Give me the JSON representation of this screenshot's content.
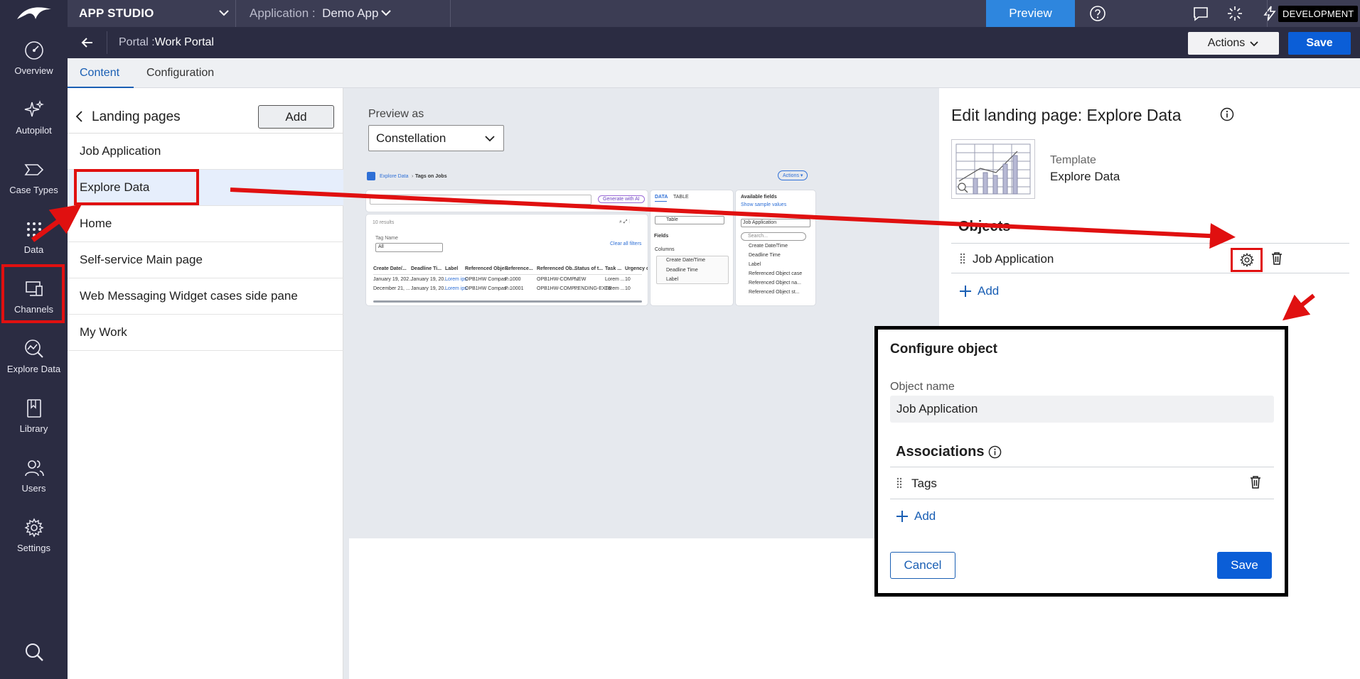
{
  "topbar": {
    "studio": "APP STUDIO",
    "app_label": "Application :",
    "app_name": "Demo App",
    "preview": "Preview",
    "environment": "DEVELOPMENT",
    "icons": [
      "help-icon",
      "chat-icon",
      "loader-icon",
      "lightning-icon",
      "hierarchy-icon"
    ]
  },
  "subbar": {
    "portal_label": "Portal :",
    "portal_name": "Work Portal",
    "actions": "Actions",
    "save": "Save"
  },
  "rail": {
    "items": [
      {
        "label": "Overview",
        "icon": "gauge-icon"
      },
      {
        "label": "Autopilot",
        "icon": "sparkle-icon"
      },
      {
        "label": "Case Types",
        "icon": "chevron-shape-icon"
      },
      {
        "label": "Data",
        "icon": "dots-grid-icon"
      },
      {
        "label": "Channels",
        "icon": "monitor-icon"
      },
      {
        "label": "Explore Data",
        "icon": "chart-search-icon"
      },
      {
        "label": "Library",
        "icon": "book-icon"
      },
      {
        "label": "Users",
        "icon": "users-icon"
      },
      {
        "label": "Settings",
        "icon": "gear-icon"
      }
    ]
  },
  "tabs": [
    {
      "label": "Content",
      "active": true
    },
    {
      "label": "Configuration",
      "active": false
    }
  ],
  "landing": {
    "title": "Landing pages",
    "add": "Add",
    "items": [
      {
        "label": "Job Application",
        "selected": false
      },
      {
        "label": "Explore Data",
        "selected": true
      },
      {
        "label": "Home",
        "selected": false
      },
      {
        "label": "Self-service Main page",
        "selected": false
      },
      {
        "label": "Web Messaging Widget cases side pane",
        "selected": false
      },
      {
        "label": "My Work",
        "selected": false
      }
    ]
  },
  "preview": {
    "label": "Preview as",
    "value": "Constellation",
    "mini": {
      "crumb1": "Explore Data",
      "crumb2": "Tags on Jobs",
      "actions": "Actions ▾",
      "gen_ai": "Generate with AI",
      "results": "10 results",
      "tag_name": "Tag Name",
      "tag_value": "All",
      "clear": "Clear all filters",
      "columns": [
        "Create Date/...",
        "Deadline Ti...",
        "Label",
        "Referenced Obje...",
        "Reference...",
        "Referenced Ob...",
        "Status of t...",
        "Task ...",
        "Urgency o..."
      ],
      "row1": [
        "January 19, 202...",
        "January 19, 20...",
        "Lorem ips",
        "OPB1HW Compas...",
        "P-1000",
        "OPB1HW-COMP...",
        "NEW",
        "Lorem ...",
        "10"
      ],
      "row2": [
        "December 21, ...",
        "January 19, 20...",
        "Lorem ips",
        "OPB1HW Compas...",
        "P-10001",
        "OPB1HW-COMP...",
        "PENDING-EXTE",
        "Lorem ...",
        "10"
      ],
      "data_tab": "DATA",
      "table_tab": "TABLE",
      "table_value": "Table",
      "fields": "Fields",
      "columns_lbl": "Columns",
      "col_items": [
        "Create Date/Time",
        "Deadline Time",
        "Label"
      ],
      "available": "Available fields",
      "show_sample": "Show sample values",
      "job_app": "Job Application",
      "search": "Search...",
      "avail_items": [
        "Create Date/Time",
        "Deadline Time",
        "Label",
        "Referenced Object case",
        "Referenced Object na...",
        "Referenced Object st..."
      ]
    }
  },
  "edit": {
    "title": "Edit landing page: Explore Data",
    "template_label": "Template",
    "template_value": "Explore Data",
    "objects": "Objects",
    "object_name": "Job Application",
    "add": "Add"
  },
  "modal": {
    "title": "Configure object",
    "object_name_label": "Object name",
    "object_name_value": "Job Application",
    "associations": "Associations",
    "assoc_item": "Tags",
    "add": "Add",
    "cancel": "Cancel",
    "save": "Save"
  },
  "colors": {
    "rail": "#2b2c42",
    "topbar": "#3c3d54",
    "accent": "#0b5ed7",
    "annotation": "#e01010"
  }
}
